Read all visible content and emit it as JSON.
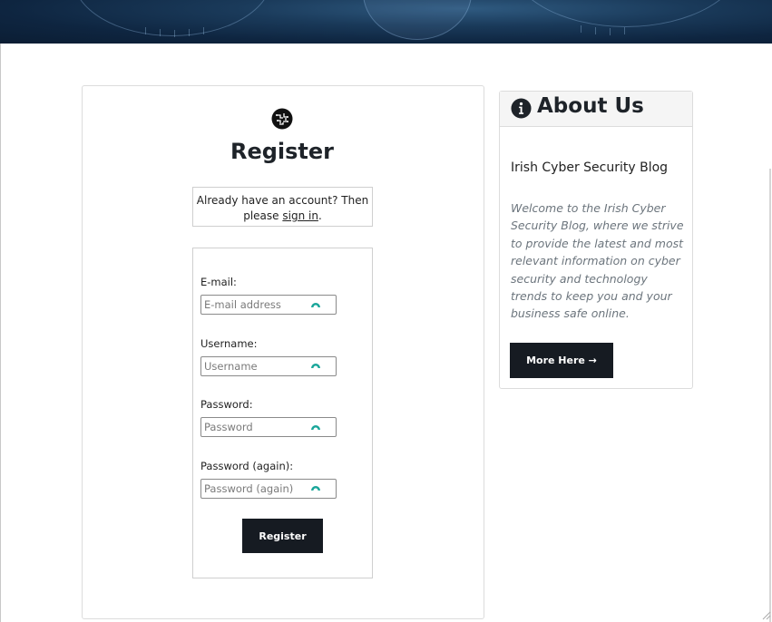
{
  "register": {
    "title": "Register",
    "signin_prompt": "Already have an account? Then please",
    "signin_link": "sign in",
    "signin_suffix": ".",
    "fields": [
      {
        "label": "E-mail:",
        "placeholder": "E-mail address"
      },
      {
        "label": "Username:",
        "placeholder": "Username"
      },
      {
        "label": "Password:",
        "placeholder": "Password"
      },
      {
        "label": "Password (again):",
        "placeholder": "Password (again)"
      }
    ],
    "submit_label": "Register"
  },
  "about": {
    "title": "About Us",
    "blog_name": "Irish Cyber Security Blog",
    "description": "Welcome to the Irish Cyber Security Blog, where we strive to provide the latest and most relevant information on cyber security and technology trends to keep you and your business safe online.",
    "more_label": "More Here →"
  },
  "icons": {
    "logo": "brain-circuit-logo-icon",
    "info": "info-circle-icon",
    "field_helper": "password-manager-icon"
  },
  "colors": {
    "button_bg": "#161b22",
    "field_icon": "#1aa69a",
    "hero_bg": "#0e2540"
  }
}
